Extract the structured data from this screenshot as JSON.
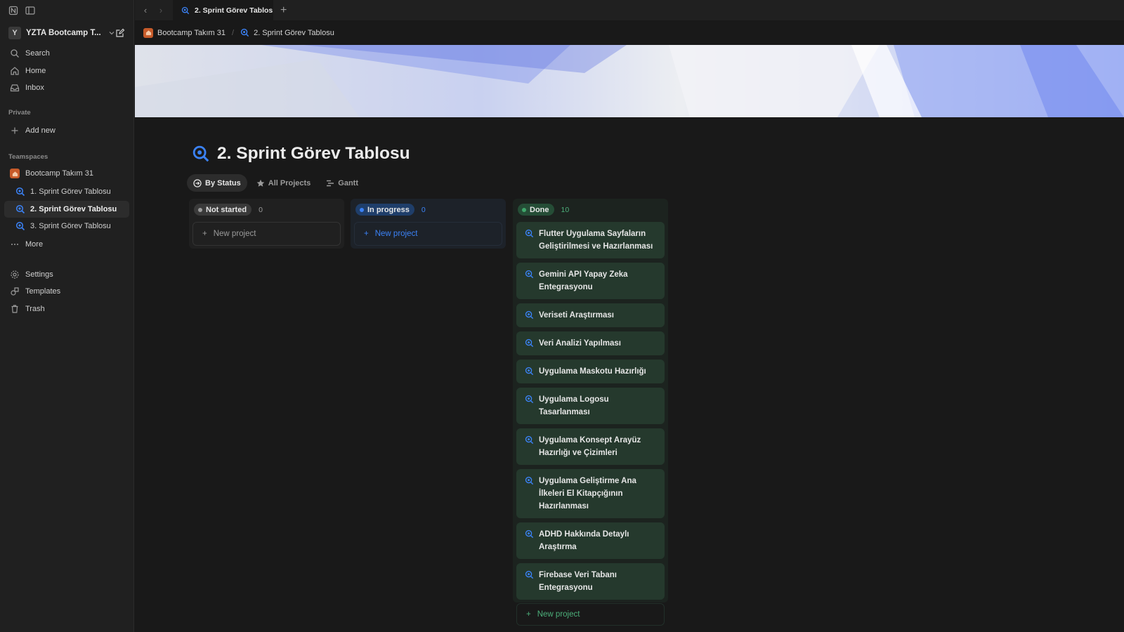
{
  "sidebar": {
    "workspace_initial": "Y",
    "workspace_name": "YZTA Bootcamp T...",
    "search": "Search",
    "home": "Home",
    "inbox": "Inbox",
    "private_section": "Private",
    "add_new": "Add new",
    "teamspaces_section": "Teamspaces",
    "teamspace": "Bootcamp Takım 31",
    "pages": [
      "1. Sprint Görev Tablosu",
      "2. Sprint Görev Tablosu",
      "3. Sprint Görev Tablosu"
    ],
    "more": "More",
    "settings": "Settings",
    "templates": "Templates",
    "trash": "Trash"
  },
  "tabbar": {
    "tab_title": "2. Sprint Görev Tablos...",
    "add": "+"
  },
  "breadcrumb": {
    "items": [
      "Bootcamp Takım 31",
      "2. Sprint Görev Tablosu"
    ]
  },
  "page": {
    "title": "2. Sprint Görev Tablosu",
    "views": [
      "By Status",
      "All Projects",
      "Gantt"
    ]
  },
  "board": {
    "columns": [
      {
        "label": "Not started",
        "count": "0",
        "new_label": "New project"
      },
      {
        "label": "In progress",
        "count": "0",
        "new_label": "New project"
      },
      {
        "label": "Done",
        "count": "10",
        "new_label": "New project"
      }
    ],
    "done_cards": [
      "Flutter Uygulama Sayfaların Geliştirilmesi ve Hazırlanması",
      "Gemini API Yapay Zeka Entegrasyonu",
      "Veriseti Araştırması",
      "Veri Analizi Yapılması",
      "Uygulama Maskotu Hazırlığı",
      "Uygulama Logosu Tasarlanması",
      "Uygulama Konsept Arayüz Hazırlığı ve Çizimleri",
      "Uygulama Geliştirme Ana İlkeleri El Kitapçığının Hazırlanması",
      "ADHD Hakkında Detaylı Araştırma",
      "Firebase Veri Tabanı Entegrasyonu"
    ]
  },
  "colors": {
    "accent_blue": "#3b82f6",
    "done_green": "#4caf7a",
    "card_bg": "#25392d"
  }
}
